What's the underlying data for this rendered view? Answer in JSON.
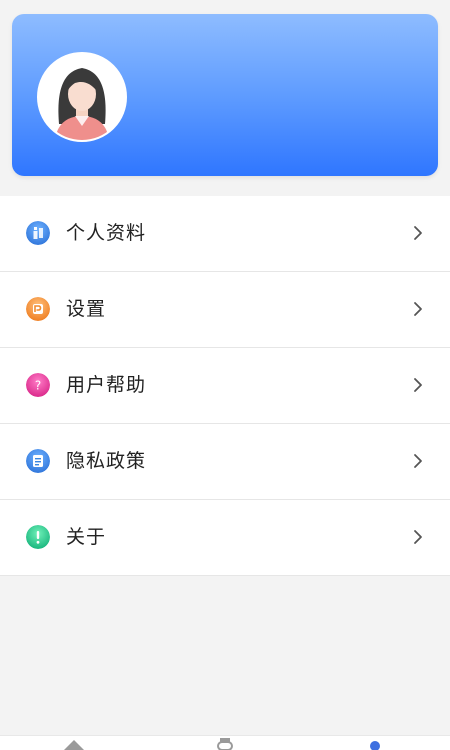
{
  "menu": {
    "items": [
      {
        "label": "个人资料",
        "icon": "profile-icon",
        "color": "#3a86e0"
      },
      {
        "label": "设置",
        "icon": "settings-icon",
        "color": "#f28a2b"
      },
      {
        "label": "用户帮助",
        "icon": "help-icon",
        "color": "#e6369d"
      },
      {
        "label": "隐私政策",
        "icon": "privacy-icon",
        "color": "#3a86e0"
      },
      {
        "label": "关于",
        "icon": "about-icon",
        "color": "#23c48a"
      }
    ]
  },
  "tabbar": {
    "tabs": [
      {
        "icon": "home-icon",
        "active": false
      },
      {
        "icon": "watch-icon",
        "active": false
      },
      {
        "icon": "user-icon",
        "active": true
      }
    ]
  }
}
